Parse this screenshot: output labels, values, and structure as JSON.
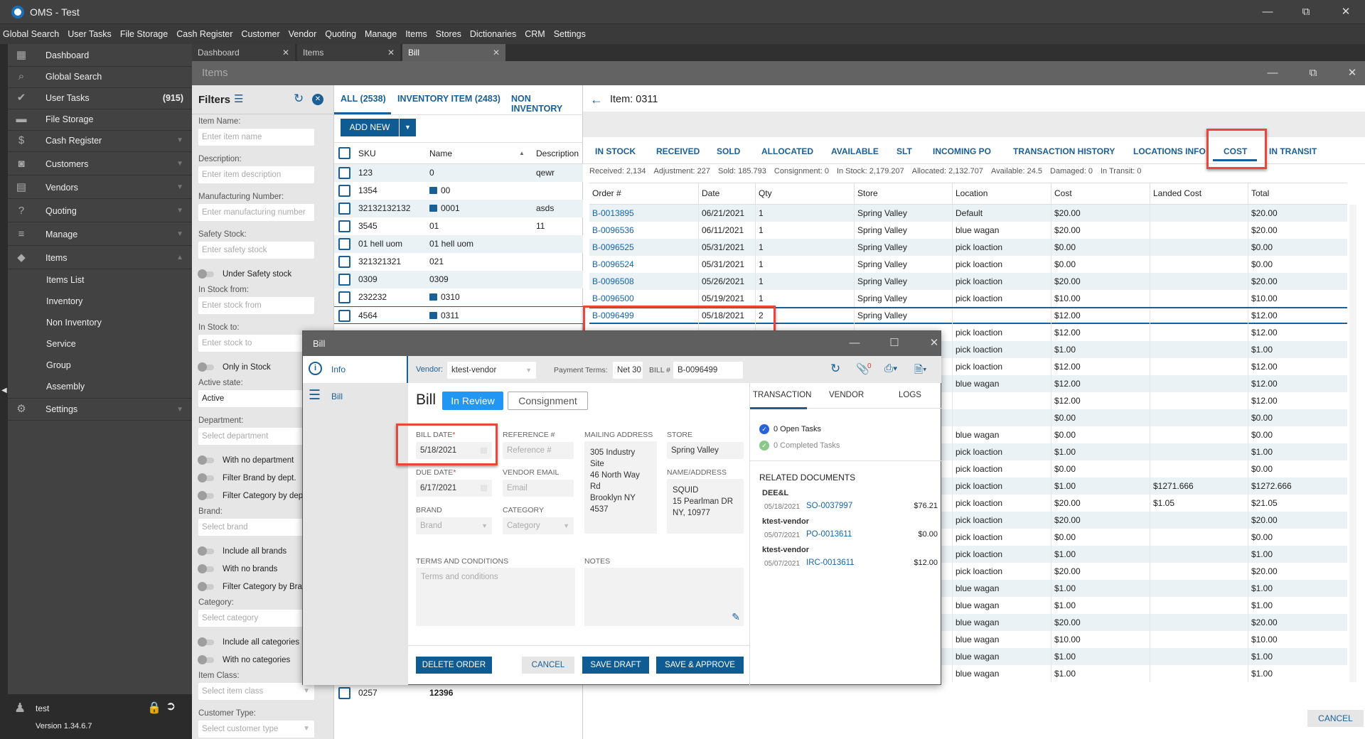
{
  "app": {
    "title": "OMS - Test",
    "menu": [
      "Global Search",
      "User Tasks",
      "File Storage",
      "Cash Register",
      "Customer",
      "Vendor",
      "Quoting",
      "Manage",
      "Items",
      "Stores",
      "Dictionaries",
      "CRM",
      "Settings"
    ]
  },
  "sidebar": {
    "items": [
      {
        "label": "Dashboard",
        "icon": "dashboard-icon",
        "glyph": "▦"
      },
      {
        "label": "Global Search",
        "icon": "search-icon",
        "glyph": "⌕"
      },
      {
        "label": "User Tasks",
        "icon": "check-circle-icon",
        "glyph": "✔",
        "count": "(915)"
      },
      {
        "label": "File Storage",
        "icon": "folder-icon",
        "glyph": "▬"
      },
      {
        "label": "Cash Register",
        "icon": "dollar-icon",
        "glyph": "$",
        "chevron": "down"
      },
      {
        "label": "Customers",
        "icon": "person-icon",
        "glyph": "◙",
        "chevron": "down"
      },
      {
        "label": "Vendors",
        "icon": "store-icon",
        "glyph": "▤",
        "chevron": "down"
      },
      {
        "label": "Quoting",
        "icon": "clipboard-question-icon",
        "glyph": "?",
        "chevron": "down"
      },
      {
        "label": "Manage",
        "icon": "clipboard-icon",
        "glyph": "≡",
        "chevron": "down"
      },
      {
        "label": "Items",
        "icon": "tag-icon",
        "glyph": "◆",
        "chevron": "up"
      }
    ],
    "sub_items": [
      "Items List",
      "Inventory",
      "Non Inventory",
      "Service",
      "Group",
      "Assembly"
    ],
    "settings": {
      "label": "Settings",
      "icon": "gear-icon",
      "glyph": "⚙"
    },
    "user": {
      "name": "test",
      "version": "Version 1.34.6.7"
    }
  },
  "doc_tabs": [
    {
      "label": "Dashboard"
    },
    {
      "label": "Items"
    },
    {
      "label": "Bill"
    }
  ],
  "panel_title": "Items",
  "filters": {
    "title": "Filters",
    "fields": [
      {
        "type": "input",
        "label": "Item Name:",
        "placeholder": "Enter item name"
      },
      {
        "type": "input",
        "label": "Description:",
        "placeholder": "Enter item description"
      },
      {
        "type": "input",
        "label": "Manufacturing Number:",
        "placeholder": "Enter manufacturing number"
      },
      {
        "type": "input",
        "label": "Safety Stock:",
        "placeholder": "Enter safety stock"
      },
      {
        "type": "toggle",
        "label": "Under Safety stock"
      },
      {
        "type": "input",
        "label": "In Stock from:",
        "placeholder": "Enter stock from"
      },
      {
        "type": "input",
        "label": "In Stock to:",
        "placeholder": "Enter stock to"
      },
      {
        "type": "toggle",
        "label": "Only in Stock"
      },
      {
        "type": "input",
        "label": "Active state:",
        "value": "Active"
      },
      {
        "type": "input",
        "label": "Department:",
        "placeholder": "Select department"
      },
      {
        "type": "toggle",
        "label": "With no department"
      },
      {
        "type": "toggle",
        "label": "Filter Brand by dept."
      },
      {
        "type": "toggle",
        "label": "Filter Category by dept."
      },
      {
        "type": "input",
        "label": "Brand:",
        "placeholder": "Select brand"
      },
      {
        "type": "toggle",
        "label": "Include all brands"
      },
      {
        "type": "toggle",
        "label": "With no brands"
      },
      {
        "type": "toggle",
        "label": "Filter Category by Brand"
      },
      {
        "type": "input",
        "label": "Category:",
        "placeholder": "Select category"
      },
      {
        "type": "toggle",
        "label": "Include all categories"
      },
      {
        "type": "toggle",
        "label": "With no categories"
      },
      {
        "type": "select",
        "label": "Item Class:",
        "placeholder": "Select item class"
      },
      {
        "type": "select",
        "label": "Customer Type:",
        "placeholder": "Select customer type"
      }
    ]
  },
  "items_list": {
    "tabs": [
      "ALL (2538)",
      "INVENTORY ITEM (2483)",
      "NON INVENTORY"
    ],
    "add_new": "ADD NEW",
    "columns": [
      "SKU",
      "Name",
      "Description"
    ],
    "rows": [
      {
        "sku": "123",
        "name": "0",
        "description": "qewr",
        "image": false
      },
      {
        "sku": "1354",
        "name": "00",
        "description": "",
        "image": true
      },
      {
        "sku": "32132132132",
        "name": "0001",
        "description": "asds",
        "image": true
      },
      {
        "sku": "3545",
        "name": "01",
        "description": "11",
        "image": false
      },
      {
        "sku": "01 hell uom",
        "name": "01 hell uom",
        "description": "",
        "image": false
      },
      {
        "sku": "321321321",
        "name": "021",
        "description": "",
        "image": false
      },
      {
        "sku": "0309",
        "name": "0309",
        "description": "",
        "image": false
      },
      {
        "sku": "232232",
        "name": "0310",
        "description": "",
        "image": true
      },
      {
        "sku": "4564",
        "name": "0311",
        "description": "",
        "image": true
      }
    ],
    "bottom_row": {
      "sku": "0257",
      "name": "12396"
    }
  },
  "item_detail": {
    "title": "Item: 0311",
    "tabs": [
      "IN STOCK",
      "RECEIVED",
      "SOLD",
      "ALLOCATED",
      "AVAILABLE",
      "SLT",
      "INCOMING PO",
      "TRANSACTION HISTORY",
      "LOCATIONS INFO",
      "COST",
      "IN TRANSIT"
    ],
    "active_tab": "COST",
    "stats": [
      "Received: 2,134",
      "Adjustment: 227",
      "Sold: 185.793",
      "Consignment: 0",
      "In Stock: 2,179.207",
      "Allocated: 2,132.707",
      "Available: 24.5",
      "Damaged: 0",
      "In Transit: 0"
    ],
    "columns": [
      "Order #",
      "Date",
      "Qty",
      "Store",
      "Location",
      "Cost",
      "Landed Cost",
      "Total"
    ],
    "rows": [
      {
        "order": "B-0013895",
        "date": "06/21/2021",
        "qty": "1",
        "store": "Spring Valley",
        "location": "Default",
        "cost": "$20.00",
        "landed": "",
        "total": "$20.00"
      },
      {
        "order": "B-0096536",
        "date": "06/11/2021",
        "qty": "1",
        "store": "Spring Valley",
        "location": "blue wagan",
        "cost": "$20.00",
        "landed": "",
        "total": "$20.00"
      },
      {
        "order": "B-0096525",
        "date": "05/31/2021",
        "qty": "1",
        "store": "Spring Valley",
        "location": "pick loaction",
        "cost": "$0.00",
        "landed": "",
        "total": "$0.00"
      },
      {
        "order": "B-0096524",
        "date": "05/31/2021",
        "qty": "1",
        "store": "Spring Valley",
        "location": "pick loaction",
        "cost": "$0.00",
        "landed": "",
        "total": "$0.00"
      },
      {
        "order": "B-0096508",
        "date": "05/26/2021",
        "qty": "1",
        "store": "Spring Valley",
        "location": "pick loaction",
        "cost": "$20.00",
        "landed": "",
        "total": "$20.00"
      },
      {
        "order": "B-0096500",
        "date": "05/19/2021",
        "qty": "1",
        "store": "Spring Valley",
        "location": "pick loaction",
        "cost": "$10.00",
        "landed": "",
        "total": "$10.00"
      },
      {
        "order": "B-0096499",
        "date": "05/18/2021",
        "qty": "2",
        "store": "Spring Valley",
        "location": "",
        "cost": "$12.00",
        "landed": "",
        "total": "$12.00",
        "selected": true
      },
      {
        "location": "pick loaction",
        "cost": "$12.00",
        "landed": "",
        "total": "$12.00"
      },
      {
        "location": "pick loaction",
        "cost": "$1.00",
        "landed": "",
        "total": "$1.00"
      },
      {
        "location": "pick loaction",
        "cost": "$12.00",
        "landed": "",
        "total": "$12.00"
      },
      {
        "location": "blue wagan",
        "cost": "$12.00",
        "landed": "",
        "total": "$12.00"
      },
      {
        "location": "",
        "cost": "$12.00",
        "landed": "",
        "total": "$12.00"
      },
      {
        "location": "",
        "cost": "$0.00",
        "landed": "",
        "total": "$0.00"
      },
      {
        "location": "blue wagan",
        "cost": "$0.00",
        "landed": "",
        "total": "$0.00"
      },
      {
        "location": "pick loaction",
        "cost": "$1.00",
        "landed": "",
        "total": "$1.00"
      },
      {
        "location": "pick loaction",
        "cost": "$0.00",
        "landed": "",
        "total": "$0.00"
      },
      {
        "location": "pick loaction",
        "cost": "$1.00",
        "landed": "$1271.666",
        "total": "$1272.666"
      },
      {
        "location": "pick loaction",
        "cost": "$20.00",
        "landed": "$1.05",
        "total": "$21.05"
      },
      {
        "location": "pick loaction",
        "cost": "$20.00",
        "landed": "",
        "total": "$20.00"
      },
      {
        "location": "pick loaction",
        "cost": "$0.00",
        "landed": "",
        "total": "$0.00"
      },
      {
        "location": "pick loaction",
        "cost": "$1.00",
        "landed": "",
        "total": "$1.00"
      },
      {
        "location": "pick loaction",
        "cost": "$20.00",
        "landed": "",
        "total": "$20.00"
      },
      {
        "location": "blue wagan",
        "cost": "$1.00",
        "landed": "",
        "total": "$1.00"
      },
      {
        "location": "blue wagan",
        "cost": "$1.00",
        "landed": "",
        "total": "$1.00"
      },
      {
        "location": "blue wagan",
        "cost": "$20.00",
        "landed": "",
        "total": "$20.00"
      },
      {
        "location": "blue wagan",
        "cost": "$10.00",
        "landed": "",
        "total": "$10.00"
      },
      {
        "location": "blue wagan",
        "cost": "$1.00",
        "landed": "",
        "total": "$1.00"
      },
      {
        "location": "blue wagan",
        "cost": "$1.00",
        "landed": "",
        "total": "$1.00"
      }
    ],
    "cancel": "CANCEL"
  },
  "bill_modal": {
    "title": "Bill",
    "nav": [
      {
        "label": "Info",
        "icon": "info-icon"
      },
      {
        "label": "Bill",
        "icon": "list-icon"
      }
    ],
    "vendor_label": "Vendor:",
    "vendor": "ktest-vendor",
    "payment_terms_label": "Payment Terms:",
    "payment_terms": "Net 30",
    "bill_no_label": "BILL #",
    "bill_no": "B-0096499",
    "attachments_count": "0",
    "heading": "Bill",
    "status": "In Review",
    "type_badge": "Consignment",
    "bill_date_label": "BILL DATE",
    "bill_date": "5/18/2021",
    "due_date_label": "DUE DATE",
    "due_date": "6/17/2021",
    "reference_label": "REFERENCE #",
    "reference_placeholder": "Reference #",
    "vendor_email_label": "VENDOR EMAIL",
    "vendor_email_placeholder": "Email",
    "mailing_label": "MAILING ADDRESS",
    "mailing_address": [
      "305 Industry",
      "Site",
      "46 North Way",
      "Rd",
      "Brooklyn NY",
      "4537"
    ],
    "store_label": "STORE",
    "store": "Spring Valley",
    "name_address_label": "NAME/ADDRESS",
    "name_address": [
      "SQUID",
      "15 Pearlman DR",
      "NY, 10977"
    ],
    "brand_label": "BRAND",
    "brand_placeholder": "Brand",
    "category_label": "CATEGORY",
    "category_placeholder": "Category",
    "terms_label": "TERMS AND CONDITIONS",
    "terms_placeholder": "Terms and conditions",
    "notes_label": "NOTES",
    "buttons": {
      "delete": "DELETE ORDER",
      "cancel": "CANCEL",
      "save_draft": "SAVE DRAFT",
      "save_approve": "SAVE & APPROVE"
    },
    "side_tabs": [
      "TRANSACTION",
      "VENDOR",
      "LOGS"
    ],
    "tasks": {
      "open": "0 Open Tasks",
      "completed": "0 Completed Tasks"
    },
    "related_title": "RELATED DOCUMENTS",
    "related": [
      {
        "party": "DEE&L",
        "date": "05/18/2021",
        "doc": "SO-0037997",
        "amount": "$76.21"
      },
      {
        "party": "ktest-vendor",
        "date": "05/07/2021",
        "doc": "PO-0013611",
        "amount": "$0.00"
      },
      {
        "party": "ktest-vendor",
        "date": "05/07/2021",
        "doc": "IRC-0013611",
        "amount": "$12.00"
      }
    ]
  },
  "colors": {
    "accent": "#0f5c94",
    "link": "#1565a8",
    "highlight": "#e8473b",
    "status_blue": "#2196f3"
  }
}
